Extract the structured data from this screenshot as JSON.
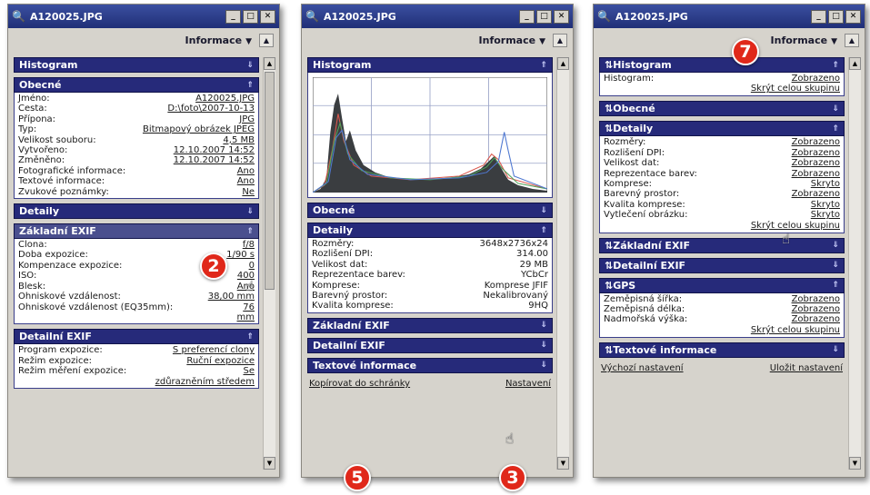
{
  "windows": [
    {
      "title": "A120025.JPG",
      "toolbar_label": "Informace",
      "sections": [
        {
          "header": "Histogram"
        },
        {
          "header": "Obecné",
          "rows": [
            {
              "k": "Jméno:",
              "v": "A120025.JPG"
            },
            {
              "k": "Cesta:",
              "v": "D:\\foto\\2007-10-13"
            },
            {
              "k": "Přípona:",
              "v": "JPG"
            },
            {
              "k": "Typ:",
              "v": "Bitmapový obrázek JPEG"
            },
            {
              "k": "Velikost souboru:",
              "v": "4,5 MB"
            },
            {
              "k": "Vytvořeno:",
              "v": "12.10.2007 14:52"
            },
            {
              "k": "Změněno:",
              "v": "12.10.2007 14:52"
            },
            {
              "k": "Fotografické informace:",
              "v": "Ano"
            },
            {
              "k": "Textové informace:",
              "v": "Ano"
            },
            {
              "k": "Zvukové poznámky:",
              "v": "Ne"
            }
          ]
        },
        {
          "header": "Detaily"
        },
        {
          "header": "Základní EXIF",
          "rows": [
            {
              "k": "Clona:",
              "v": "f/8"
            },
            {
              "k": "Doba expozice:",
              "v": "1/90 s"
            },
            {
              "k": "Kompenzace expozice:",
              "v": "0"
            },
            {
              "k": "ISO:",
              "v": "400"
            },
            {
              "k": "Blesk:",
              "v": "Ano"
            },
            {
              "k": "Ohniskové vzdálenost:",
              "v": "38,00 mm"
            },
            {
              "k": "Ohniskové vzdálenost (EQ35mm):",
              "v": "76"
            },
            {
              "k": "",
              "v": "mm"
            }
          ]
        },
        {
          "header": "Detailní EXIF",
          "rows": [
            {
              "k": "Program expozice:",
              "v": "S preferencí clony"
            },
            {
              "k": "Režim expozice:",
              "v": "Ruční expozice"
            },
            {
              "k": "Režim měření expozice:",
              "v": "Se"
            },
            {
              "k": "",
              "v": "zdůrazněním středem"
            }
          ]
        }
      ]
    },
    {
      "title": "A120025.JPG",
      "toolbar_label": "Informace",
      "sections": [
        {
          "header": "Histogram"
        },
        {
          "header": "Obecné"
        },
        {
          "header": "Detaily",
          "rows": [
            {
              "k": "Rozměry:",
              "v": "3648x2736x24"
            },
            {
              "k": "Rozlišení DPI:",
              "v": "314.00"
            },
            {
              "k": "Velikost dat:",
              "v": "29 MB"
            },
            {
              "k": "Reprezentace barev:",
              "v": "YCbCr"
            },
            {
              "k": "Komprese:",
              "v": "Komprese JFIF"
            },
            {
              "k": "Barevný prostor:",
              "v": "Nekalibrovaný"
            },
            {
              "k": "Kvalita komprese:",
              "v": "9HQ"
            }
          ]
        },
        {
          "header": "Základní EXIF"
        },
        {
          "header": "Detailní EXIF"
        },
        {
          "header": "Textové informace"
        }
      ],
      "links": {
        "left": "Kopírovat do schránky",
        "right": "Nastavení"
      }
    },
    {
      "title": "A120025.JPG",
      "toolbar_label": "Informace",
      "sections": [
        {
          "header": "Histogram",
          "rows": [
            {
              "k": "Histogram:",
              "v": "Zobrazeno"
            }
          ],
          "foot": "Skrýt celou skupinu"
        },
        {
          "header": "Obecné"
        },
        {
          "header": "Detaily",
          "rows": [
            {
              "k": "Rozměry:",
              "v": "Zobrazeno"
            },
            {
              "k": "Rozlišení DPI:",
              "v": "Zobrazeno"
            },
            {
              "k": "Velikost dat:",
              "v": "Zobrazeno"
            },
            {
              "k": "Reprezentace barev:",
              "v": "Zobrazeno"
            },
            {
              "k": "Komprese:",
              "v": "Skryto"
            },
            {
              "k": "Barevný prostor:",
              "v": "Zobrazeno"
            },
            {
              "k": "Kvalita komprese:",
              "v": "Skryto"
            },
            {
              "k": "Vytlečení obrázku:",
              "v": "Skryto"
            }
          ],
          "foot": "Skrýt celou skupinu"
        },
        {
          "header": "Základní EXIF"
        },
        {
          "header": "Detailní EXIF"
        },
        {
          "header": "GPS",
          "rows": [
            {
              "k": "Zeměpisná šířka:",
              "v": "Zobrazeno"
            },
            {
              "k": "Zeměpisná délka:",
              "v": "Zobrazeno"
            },
            {
              "k": "Nadmořská výška:",
              "v": "Zobrazeno"
            }
          ],
          "foot": "Skrýt celou skupinu"
        },
        {
          "header": "Textové informace"
        }
      ],
      "links": {
        "left": "Výchozí nastavení",
        "right": "Uložit nastavení"
      }
    }
  ],
  "badges": [
    "2",
    "5",
    "3",
    "7"
  ],
  "colors": {
    "section_header": "#262a7a",
    "title_bar": "#202f77",
    "badge": "#e0281a"
  }
}
